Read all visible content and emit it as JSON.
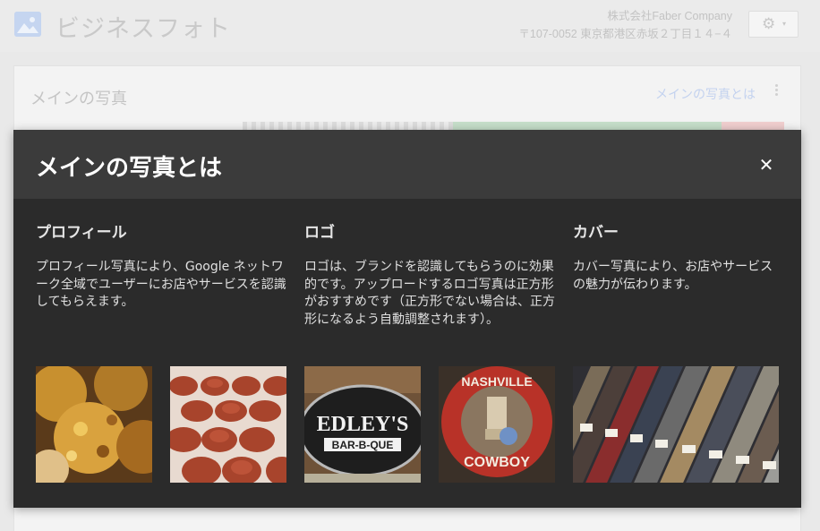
{
  "app": {
    "title": "ビジネスフォト",
    "icon": "photo-icon"
  },
  "company": {
    "name": "株式会社Faber Company",
    "address": "〒107-0052 東京都港区赤坂２丁目１４−４"
  },
  "settings": {
    "icon": "gear-icon",
    "caret": "▾"
  },
  "card": {
    "title": "メインの写真",
    "link": "メインの写真とは"
  },
  "modal": {
    "title": "メインの写真とは",
    "close": "✕",
    "columns": [
      {
        "heading": "プロフィール",
        "description": "プロフィール写真により、Google ネットワーク全域でユーザーにお店やサービスを認識してもらえます。"
      },
      {
        "heading": "ロゴ",
        "description": "ロゴは、ブランドを認識してもらうのに効果的です。アップロードするロゴ写真は正方形がおすすめです（正方形でない場合は、正方形になるよう自動調整されます）。"
      },
      {
        "heading": "カバー",
        "description": "カバー写真により、お店やサービスの魅力が伝わります。"
      }
    ],
    "logo_signs": {
      "bbq_name": "EDLEY'S",
      "bbq_sub": "BAR-B-QUE",
      "cowboy_top": "NASHVILLE",
      "cowboy_bottom": "COWBOY"
    }
  },
  "colors": {
    "modal_bg": "#2b2b2b",
    "modal_header": "#3b3b3b",
    "link_blue": "#c3d2ef"
  }
}
